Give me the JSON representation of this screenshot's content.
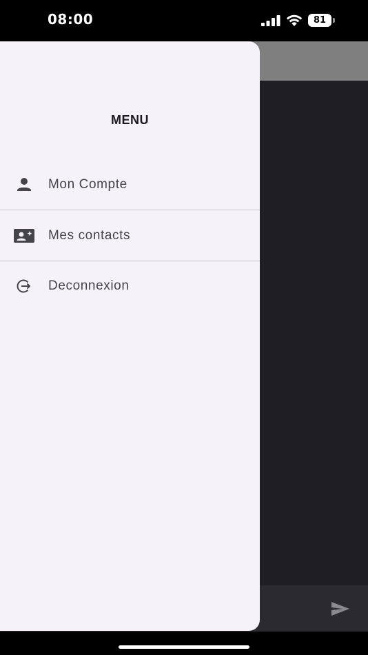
{
  "status_bar": {
    "time": "08:00",
    "battery_level": "81",
    "icons": [
      "signal-icon",
      "wifi-icon",
      "battery-icon"
    ]
  },
  "drawer": {
    "title": "MENU",
    "items": [
      {
        "label": "Mon Compte",
        "icon": "person-icon"
      },
      {
        "label": "Mes contacts",
        "icon": "contact-card-icon"
      },
      {
        "label": "Deconnexion",
        "icon": "logout-icon"
      }
    ]
  },
  "background_app": {
    "icons": [
      "send-icon"
    ]
  },
  "colors": {
    "drawer_background": "#f6f2f9",
    "scrim": "#1e1e24",
    "header_gray": "#7f7f7f",
    "text_primary": "#1c1b1f",
    "text_secondary": "#46444b",
    "divider": "#c9c5cc"
  }
}
